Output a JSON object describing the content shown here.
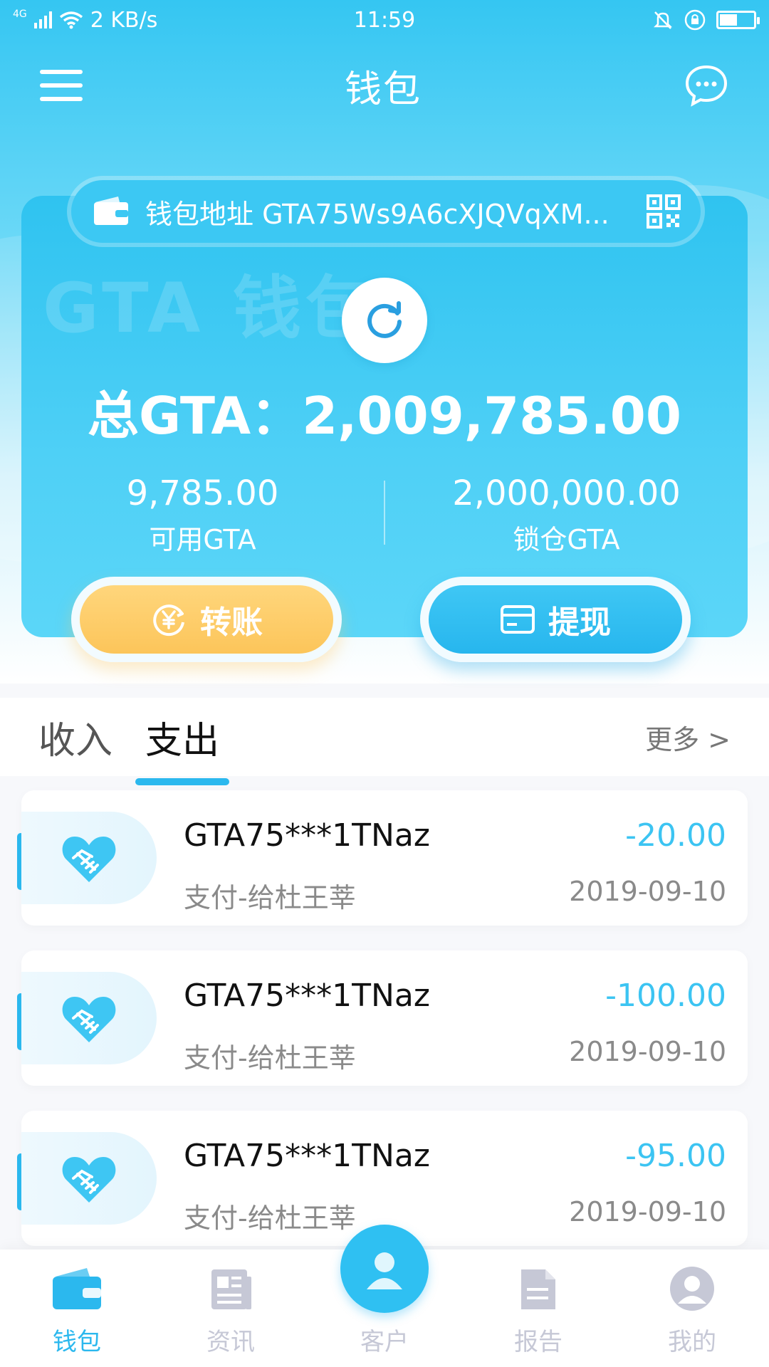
{
  "status_bar": {
    "network_label": "4G",
    "speed": "2 KB/s",
    "time": "11:59"
  },
  "header": {
    "title": "钱包"
  },
  "wallet": {
    "watermark": "GTA 钱包",
    "address_text": "钱包地址 GTA75Ws9A6cXJQVqXM...",
    "total_label": "总GTA：2,009,785.00",
    "available_value": "9,785.00",
    "available_label": "可用GTA",
    "locked_value": "2,000,000.00",
    "locked_label": "锁仓GTA",
    "transfer_label": "转账",
    "withdraw_label": "提现"
  },
  "tabs": {
    "income": "收入",
    "expense": "支出",
    "more": "更多 >"
  },
  "transactions": [
    {
      "address": "GTA75***1TNaz",
      "desc": "支付-给杜王莘",
      "amount": "-20.00",
      "date": "2019-09-10"
    },
    {
      "address": "GTA75***1TNaz",
      "desc": "支付-给杜王莘",
      "amount": "-100.00",
      "date": "2019-09-10"
    },
    {
      "address": "GTA75***1TNaz",
      "desc": "支付-给杜王莘",
      "amount": "-95.00",
      "date": "2019-09-10"
    }
  ],
  "bottom_nav": {
    "wallet": "钱包",
    "news": "资讯",
    "customer": "客户",
    "report": "报告",
    "mine": "我的"
  },
  "colors": {
    "accent": "#2bb8ee",
    "transfer": "#fcc55a",
    "amount": "#3cc4f2",
    "nav_inactive": "#c6c8d6"
  },
  "icons": {
    "menu": "menu-icon",
    "chat": "chat-icon",
    "wallet_address": "wallet-icon",
    "qr": "qr-code-icon",
    "refresh": "refresh-icon",
    "transfer": "yen-transfer-icon",
    "withdraw": "card-icon",
    "transaction": "handshake-heart-icon"
  }
}
